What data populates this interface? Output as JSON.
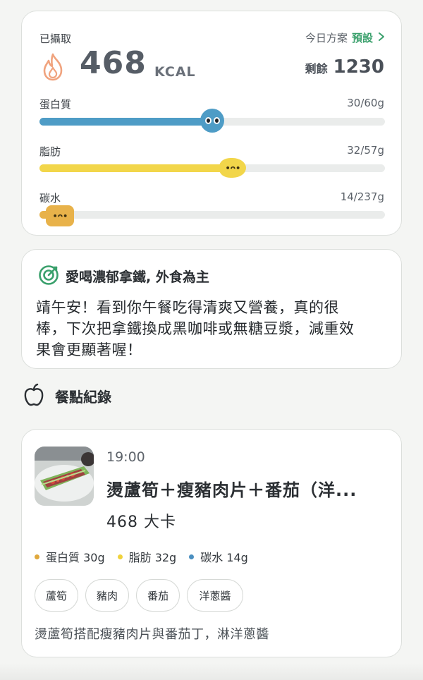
{
  "summary": {
    "intake_label": "已攝取",
    "kcal_value": "468",
    "kcal_unit": "KCAL",
    "plan_label": "今日方案",
    "plan_value": "預設",
    "remaining_label": "剩餘",
    "remaining_value": "1230",
    "macros": [
      {
        "name": "蛋白質",
        "value": "30/60g",
        "fraction": 0.5,
        "color": "#4e9cc6"
      },
      {
        "name": "脂肪",
        "value": "32/57g",
        "fraction": 0.56,
        "color": "#f2d64a"
      },
      {
        "name": "碳水",
        "value": "14/237g",
        "fraction": 0.06,
        "color": "#e8b24a"
      }
    ]
  },
  "message": {
    "title": "愛喝濃郁拿鐵, 外食為主",
    "body_lines": [
      "靖午安！看到你午餐吃得清爽又營養，真的很",
      "棒，下次把拿鐵換成黑咖啡或無糖豆漿，減重效",
      "果會更顯著喔！"
    ]
  },
  "section": {
    "title": "餐點紀錄"
  },
  "meal": {
    "time": "19:00",
    "name": "燙蘆筍＋瘦豬肉片＋番茄（洋...",
    "kcal": "468 大卡",
    "macros": [
      {
        "label": "蛋白質 30g",
        "color": "#e0a83c"
      },
      {
        "label": "脂肪 32g",
        "color": "#f0d23c"
      },
      {
        "label": "碳水 14g",
        "color": "#4a8fc0"
      }
    ],
    "tags": [
      "蘆筍",
      "豬肉",
      "番茄",
      "洋蔥醬"
    ],
    "description": "燙蘆筍搭配瘦豬肉片與番茄丁，淋洋蔥醬"
  },
  "colors": {
    "accent_green": "#3aa06c",
    "protein": "#4e9cc6",
    "fat": "#f2d64a",
    "carb": "#e8b24a",
    "flame": "#f0a37e"
  },
  "icons": {
    "flame": "flame-icon",
    "target": "target-icon",
    "apple": "apple-icon",
    "chevron": "chevron-right-icon"
  }
}
